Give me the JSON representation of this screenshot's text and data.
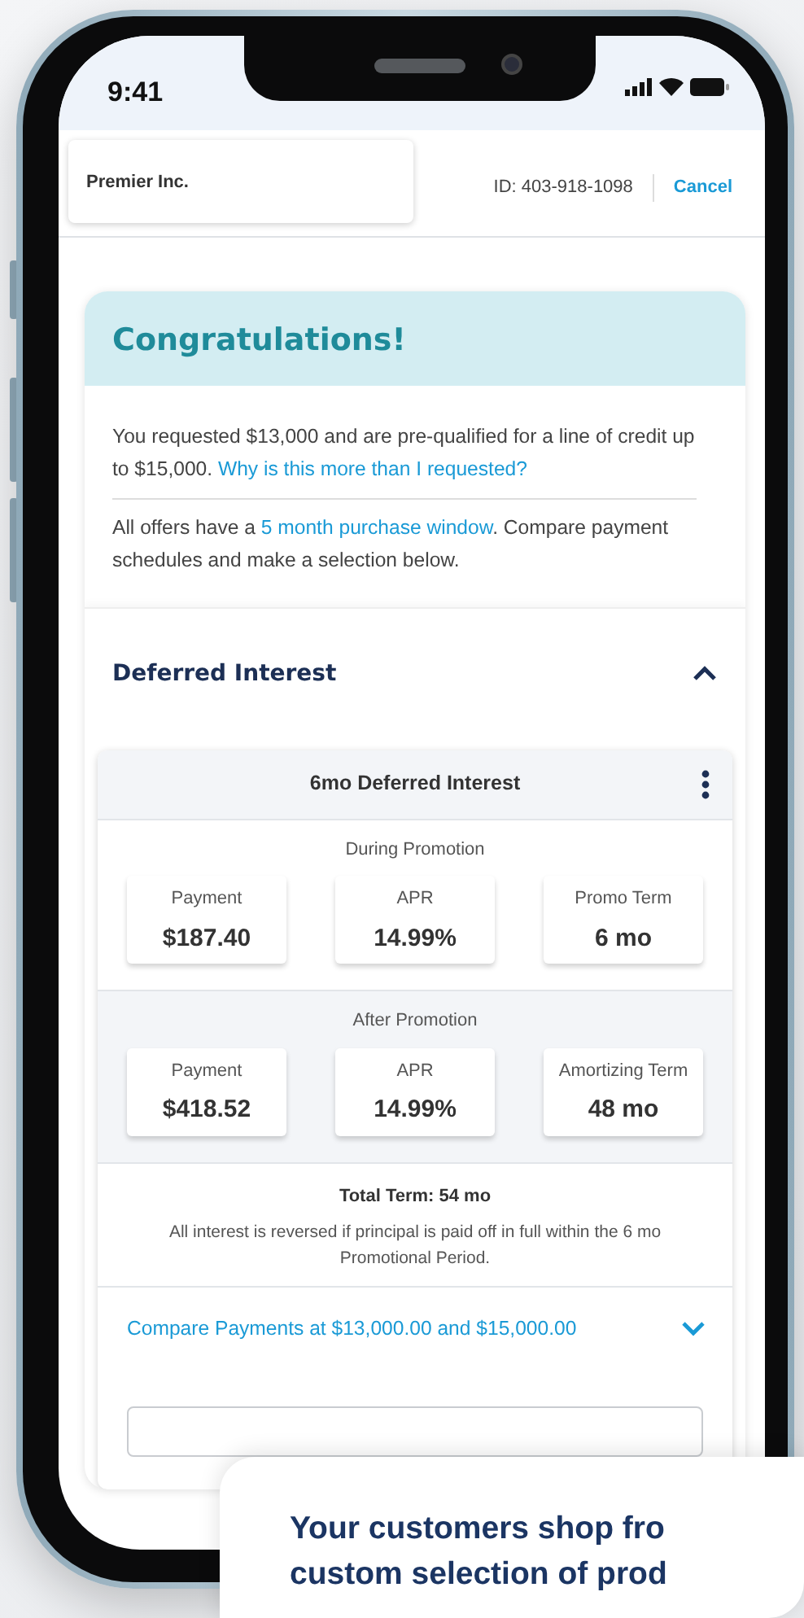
{
  "status_bar": {
    "time": "9:41"
  },
  "header": {
    "merchant_tab": "Premier Inc.",
    "account_id": "ID: 403-918-1098",
    "cancel": "Cancel"
  },
  "offer": {
    "title": "Congratulations!",
    "message": "You requested $13,000 and are pre-qualified for a line of credit up to $15,000.",
    "message_link": "Why is this more than I requested?",
    "note_before": "All offers have a",
    "note_link": "5 month purchase window",
    "note_after": ". Compare payment schedules and make a selection below."
  },
  "section": {
    "title": "Deferred Interest",
    "expanded": true,
    "plan": {
      "title": "6mo Deferred Interest",
      "groups": [
        {
          "label": "During Promotion",
          "shaded": false,
          "tiles": [
            {
              "label": "Payment",
              "value": "$187.40"
            },
            {
              "label": "APR",
              "value": "14.99%"
            },
            {
              "label": "Promo Term",
              "value": "6 mo"
            }
          ]
        },
        {
          "label": "After Promotion",
          "shaded": true,
          "tiles": [
            {
              "label": "Payment",
              "value": "$418.52"
            },
            {
              "label": "APR",
              "value": "14.99%"
            },
            {
              "label": "Amortizing Term",
              "value": "48 mo"
            }
          ]
        }
      ],
      "total_term": "Total Term: 54 mo",
      "disclaimer": "All interest is reversed if principal is paid off in full within the 6 mo Promotional Period.",
      "compare": {
        "label": "Compare Payments at $13,000.00 and $15,000.00",
        "expanded": false
      }
    }
  },
  "promo": {
    "lines": [
      "Your customers shop fro",
      "custom selection of prod"
    ]
  }
}
